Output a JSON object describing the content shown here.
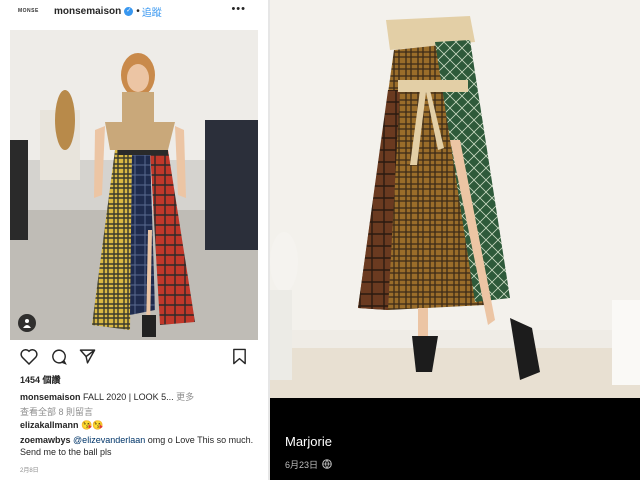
{
  "post": {
    "avatar_text": "MONSE",
    "username": "monsemaison",
    "separator": "•",
    "follow_label": "追蹤",
    "more_label": "•••",
    "likes": "1454 個讚",
    "caption_user": "monsemaison",
    "caption_text": "FALL 2020 | LOOK 5...",
    "caption_more": "更多",
    "view_comments": "查看全部 8 則留言",
    "comments": [
      {
        "user": "elizakallmann",
        "text": "😘😘"
      },
      {
        "user": "zoemawbys",
        "mention": "@elizevanderlaan",
        "text": "omg o Love This so much. Send me to the ball pls"
      }
    ],
    "date": "2月8日"
  },
  "right": {
    "title": "Marjorie",
    "date": "6月23日"
  },
  "icons": {
    "verified": "verified-badge-icon",
    "heart": "heart-icon",
    "comment": "comment-icon",
    "share": "share-icon",
    "save": "bookmark-icon",
    "tag": "user-tag-icon",
    "globe": "globe-icon"
  },
  "colors": {
    "link_blue": "#3897f0",
    "text": "#262626",
    "muted": "#8e8e8e",
    "caption_bg": "#000000"
  }
}
